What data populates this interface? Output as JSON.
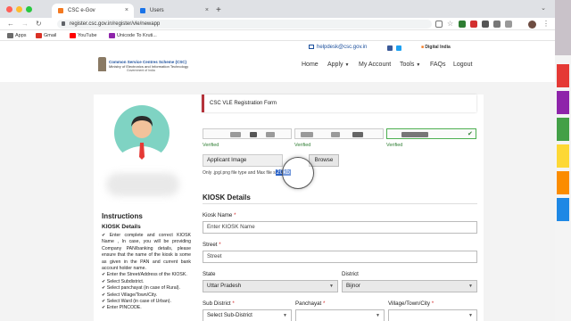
{
  "browser": {
    "tabs": [
      {
        "title": "CSC e-Gov",
        "active": true,
        "favicon_color": "#f47920"
      },
      {
        "title": "Users",
        "active": false,
        "favicon_color": "#1a73e8"
      }
    ],
    "new_tab": "+",
    "close_glyph": "×",
    "url": "register.csc.gov.in/register/vle/newapp",
    "bookmarks": [
      {
        "label": "Apps",
        "color": "#6b6b6b"
      },
      {
        "label": "Gmail",
        "color": "#d93025"
      },
      {
        "label": "YouTube",
        "color": "#ff0000"
      },
      {
        "label": "Unicode To Kruti...",
        "color": "#8e24aa"
      }
    ]
  },
  "site": {
    "helpdesk_email": "helpdesk@csc.gov.in",
    "digital_india": "Digital India",
    "org_line1": "Common Service Centres Scheme (CSC)",
    "org_line2": "Ministry of Electronics and Information Technology",
    "org_line3": "Government of India",
    "nav": [
      {
        "label": "Home",
        "caret": false
      },
      {
        "label": "Apply",
        "caret": true
      },
      {
        "label": "My Account",
        "caret": false
      },
      {
        "label": "Tools",
        "caret": true
      },
      {
        "label": "FAQs",
        "caret": false
      },
      {
        "label": "Logout",
        "caret": false
      }
    ]
  },
  "sidebar": {
    "instructions_title": "Instructions",
    "kiosk_subtitle": "KIOSK Details",
    "items": [
      "Enter complete and correct KIOSK Name , In case, you will be providing Company PAN/banking details, please ensure that the name of the kiosk is some as given in the PAN and current bank account holder name.",
      "Enter the Street/Address of the KIOSK.",
      "Select Subdistrict.",
      "Select panchayat (in case of Rural).",
      "Select Village/Town/City.",
      "Select Ward (in case of Urban).",
      "Enter PINCODE."
    ]
  },
  "form": {
    "header": "CSC VLE Registration Form",
    "verified_label": "Verified",
    "applicant_image_label": "Applicant Image",
    "browse_label": "Browse",
    "hint_prefix": "Only .jpg/.png file type and Max file s",
    "hint_highlight": "20kb",
    "kiosk_section_title": "KIOSK Details",
    "kiosk_name": {
      "label": "Kiosk Name",
      "placeholder": "Enter KIOSK Name"
    },
    "street": {
      "label": "Street",
      "value": "Street"
    },
    "state": {
      "label": "State",
      "value": "Uttar Pradesh"
    },
    "district": {
      "label": "District",
      "value": "Bijnor"
    },
    "sub_district": {
      "label": "Sub District",
      "value": "Select Sub-District"
    },
    "panchayat": {
      "label": "Panchayat",
      "value": ""
    },
    "village": {
      "label": "Village/Town/City",
      "value": ""
    },
    "required_mark": "*"
  },
  "colors": {
    "accent_red": "#b5333b",
    "link_blue": "#1b4f9c",
    "verified_green": "#2e7d32"
  }
}
